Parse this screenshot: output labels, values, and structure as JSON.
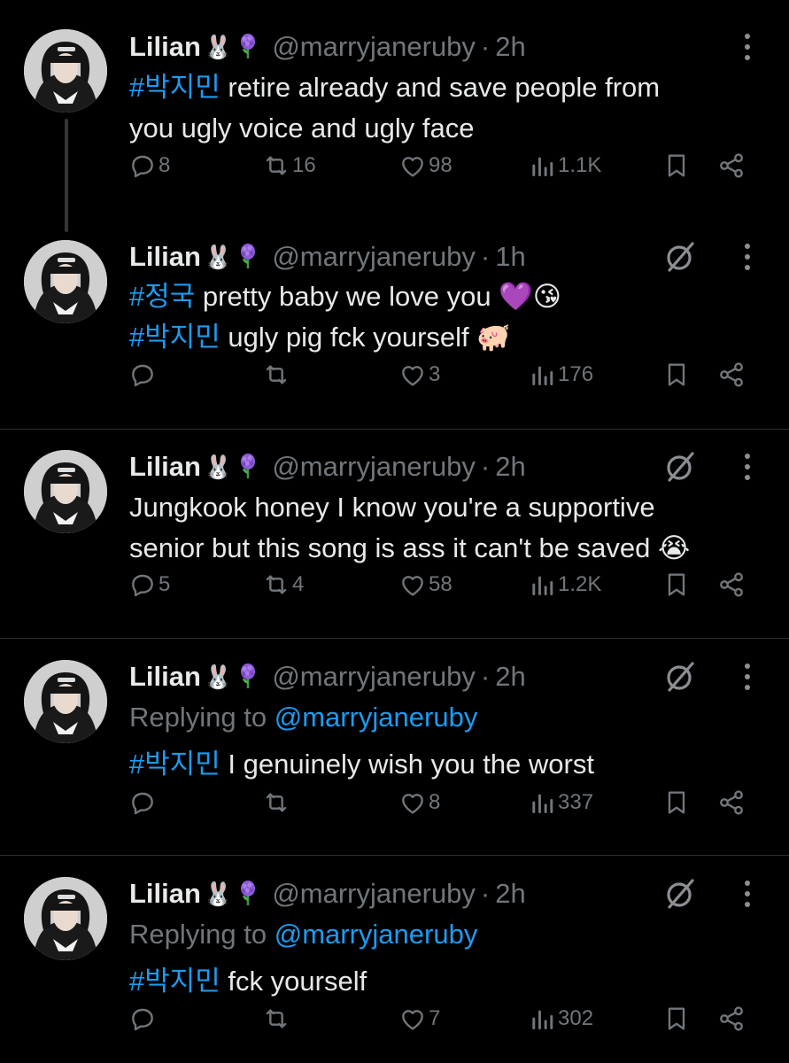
{
  "tweets": [
    {
      "name": "Lilian",
      "emoji_rabbit": "🐰",
      "handle": "@marryjaneruby",
      "separator": "·",
      "time": "2h",
      "has_grok": false,
      "replying_label": "",
      "replying_handle": "",
      "lines": [
        {
          "tag": "#박지민",
          "text": " retire already and save people  from"
        },
        {
          "tag": "",
          "text": "you ugly voice and ugly face"
        }
      ],
      "stats": {
        "replies": "8",
        "reposts": "16",
        "likes": "98",
        "views": "1.1K"
      }
    },
    {
      "name": "Lilian",
      "emoji_rabbit": "🐰",
      "handle": "@marryjaneruby",
      "separator": "·",
      "time": "1h",
      "has_grok": true,
      "replying_label": "",
      "replying_handle": "",
      "lines": [
        {
          "tag": "#정국",
          "text": " pretty baby we love you 💜😘"
        },
        {
          "tag": "#박지민",
          "text": " ugly pig fck yourself 🐖"
        }
      ],
      "stats": {
        "replies": "",
        "reposts": "",
        "likes": "3",
        "views": "176"
      }
    },
    {
      "name": "Lilian",
      "emoji_rabbit": "🐰",
      "handle": "@marryjaneruby",
      "separator": "·",
      "time": "2h",
      "has_grok": true,
      "replying_label": "",
      "replying_handle": "",
      "lines": [
        {
          "tag": "",
          "text": "Jungkook honey I know you're a supportive"
        },
        {
          "tag": "",
          "text": "senior but this song is ass it can't be saved 😭"
        }
      ],
      "stats": {
        "replies": "5",
        "reposts": "4",
        "likes": "58",
        "views": "1.2K"
      }
    },
    {
      "name": "Lilian",
      "emoji_rabbit": "🐰",
      "handle": "@marryjaneruby",
      "separator": "·",
      "time": "2h",
      "has_grok": true,
      "replying_label": "Replying to",
      "replying_handle": "@marryjaneruby",
      "lines": [
        {
          "tag": "#박지민",
          "text": " I genuinely wish you the worst"
        }
      ],
      "stats": {
        "replies": "",
        "reposts": "",
        "likes": "8",
        "views": "337"
      }
    },
    {
      "name": "Lilian",
      "emoji_rabbit": "🐰",
      "handle": "@marryjaneruby",
      "separator": "·",
      "time": "2h",
      "has_grok": true,
      "replying_label": "Replying to",
      "replying_handle": "@marryjaneruby",
      "lines": [
        {
          "tag": "#박지민",
          "text": " fck yourself"
        }
      ],
      "stats": {
        "replies": "",
        "reposts": "",
        "likes": "7",
        "views": "302"
      }
    }
  ],
  "colors": {
    "background": "#000000",
    "text": "#e7e9ea",
    "muted": "#71767b",
    "link": "#1d9bf0",
    "divider": "#2f3336",
    "purple_flower": "#8e5bd6"
  },
  "icons": [
    "reply-icon",
    "repost-icon",
    "like-icon",
    "views-icon",
    "bookmark-icon",
    "share-icon",
    "grok-icon",
    "more-icon",
    "flower-icon"
  ]
}
